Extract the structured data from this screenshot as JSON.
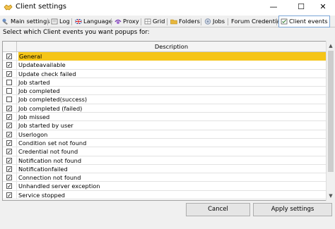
{
  "window": {
    "title": "Client settings",
    "minimize_glyph": "—",
    "maximize_glyph": "☐",
    "close_glyph": "✕"
  },
  "tabs": [
    {
      "label": "Main settings",
      "icon": "wrench-icon",
      "active": false
    },
    {
      "label": "Log",
      "icon": "log-icon",
      "active": false
    },
    {
      "label": "Language",
      "icon": "flag-icon",
      "active": false
    },
    {
      "label": "Proxy",
      "icon": "proxy-icon",
      "active": false
    },
    {
      "label": "Grid",
      "icon": "grid-icon",
      "active": false
    },
    {
      "label": "Folders",
      "icon": "folder-icon",
      "active": false
    },
    {
      "label": "Jobs",
      "icon": "jobs-icon",
      "active": false
    },
    {
      "label": "Forum Credential",
      "icon": "",
      "active": false
    },
    {
      "label": "Client events",
      "icon": "events-icon",
      "active": true
    }
  ],
  "instruction": "Select which Client events you want popups for:",
  "grid": {
    "header_description": "Description",
    "rows": [
      {
        "label": "General",
        "checked": true,
        "selected": true
      },
      {
        "label": "Updateavailable",
        "checked": true,
        "selected": false
      },
      {
        "label": "Update check failed",
        "checked": true,
        "selected": false
      },
      {
        "label": "Job started",
        "checked": false,
        "selected": false
      },
      {
        "label": "Job completed",
        "checked": false,
        "selected": false
      },
      {
        "label": "Job completed(success)",
        "checked": false,
        "selected": false
      },
      {
        "label": "Job completed (failed)",
        "checked": true,
        "selected": false
      },
      {
        "label": "Job missed",
        "checked": true,
        "selected": false
      },
      {
        "label": "Job started by user",
        "checked": true,
        "selected": false
      },
      {
        "label": "Userlogon",
        "checked": true,
        "selected": false
      },
      {
        "label": "Condition set not found",
        "checked": true,
        "selected": false
      },
      {
        "label": "Credential not found",
        "checked": true,
        "selected": false
      },
      {
        "label": "Notification not found",
        "checked": true,
        "selected": false
      },
      {
        "label": "Notificationfailed",
        "checked": true,
        "selected": false
      },
      {
        "label": "Connection not found",
        "checked": true,
        "selected": false
      },
      {
        "label": "Unhandled server exception",
        "checked": true,
        "selected": false
      },
      {
        "label": "Service stopped",
        "checked": true,
        "selected": false
      }
    ]
  },
  "buttons": {
    "cancel": "Cancel",
    "apply": "Apply settings"
  },
  "colors": {
    "selection": "#f5c518",
    "active_tab_border": "#7aa5d6"
  }
}
